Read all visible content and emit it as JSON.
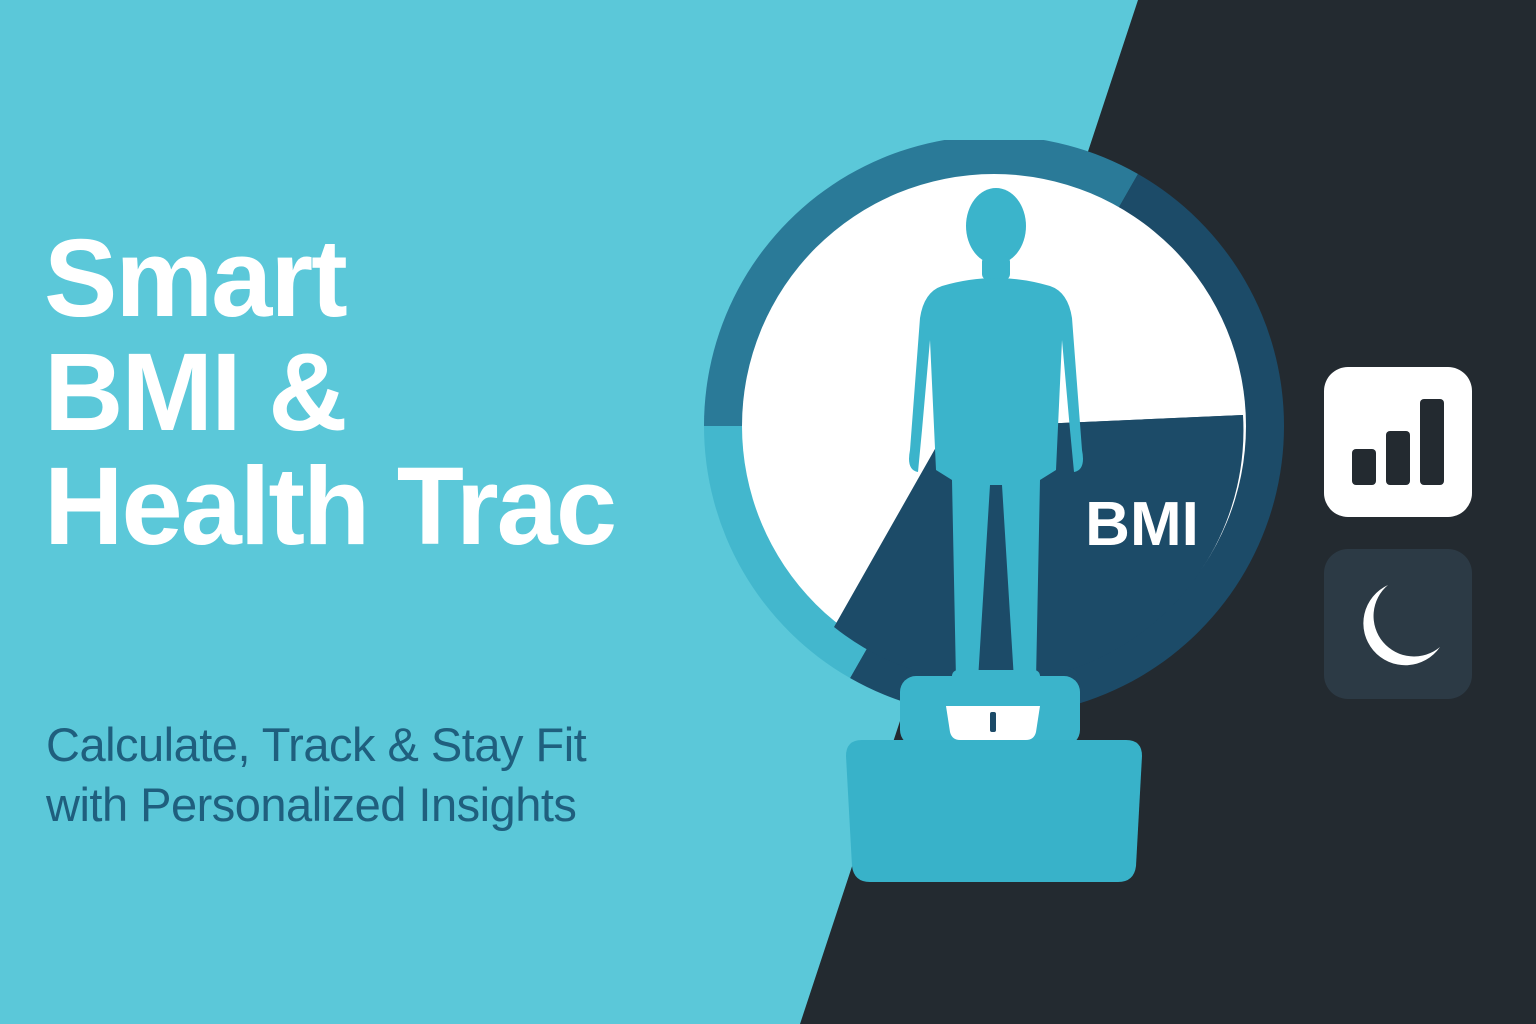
{
  "headline": {
    "lines": [
      "Smart",
      "BMI &",
      "Health Trac"
    ]
  },
  "tagline": {
    "lines": [
      "Calculate, Track & Stay Fit",
      "with Personalized Insights"
    ]
  },
  "gauge": {
    "label": "BMI"
  },
  "icons": {
    "stats": "bar-chart-icon",
    "theme": "moon-icon"
  },
  "colors": {
    "background_light": "#5bc8d9",
    "background_dark": "#232a30",
    "gauge_dark": "#1c4b68",
    "gauge_mid": "#2a7a98",
    "figure": "#3bb4cb",
    "tagline": "#1f5f7e",
    "white": "#ffffff"
  }
}
